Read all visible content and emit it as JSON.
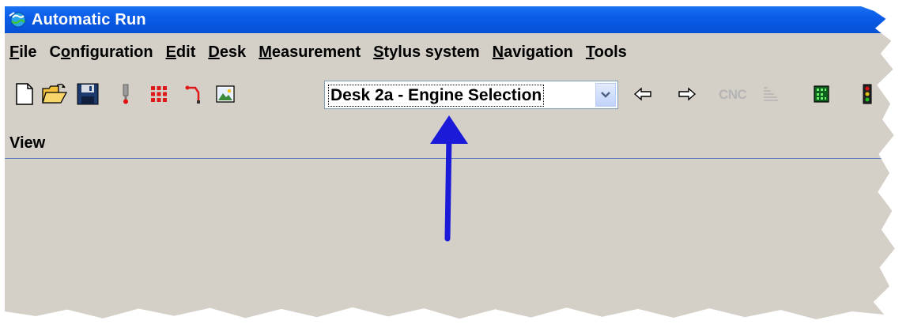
{
  "window": {
    "title": "Automatic Run"
  },
  "menu": {
    "file": {
      "u": "F",
      "rest": "ile"
    },
    "configuration": {
      "pre": "C",
      "u": "o",
      "rest": "nfiguration"
    },
    "edit": {
      "u": "E",
      "rest": "dit"
    },
    "desk": {
      "u": "D",
      "rest": "esk"
    },
    "measurement": {
      "u": "M",
      "rest": "easurement"
    },
    "stylus": {
      "u": "S",
      "rest": "tylus system"
    },
    "navigation": {
      "u": "N",
      "rest": "avigation"
    },
    "tools": {
      "u": "T",
      "rest": "ools"
    }
  },
  "toolbar": {
    "desk_selected": "Desk 2a - Engine Selection",
    "cnc_label": "CNC",
    "icons": [
      "new-file-icon",
      "open-folder-icon",
      "save-icon",
      "probe-icon",
      "grid-icon",
      "stylus-path-icon",
      "image-icon",
      "back-arrow-icon",
      "forward-arrow-icon",
      "cnc-icon",
      "lines-icon",
      "panel-icon",
      "traffic-light-icon"
    ]
  },
  "view": {
    "label": "View"
  },
  "colors": {
    "titlebar": "#0a5ce8",
    "workspace": "#d4d0c8",
    "annotation_arrow": "#1a1ad8"
  }
}
